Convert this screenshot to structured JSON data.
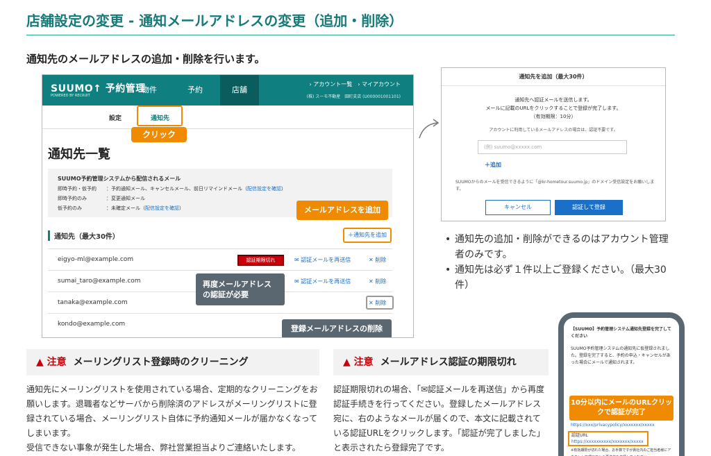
{
  "page": {
    "title": "店舗設定の変更 - 通知メールアドレスの変更（追加・削除）",
    "lead": "通知先のメールアドレスの追加・削除を行います。"
  },
  "mock": {
    "logo": "SUUMO↑ 予約管理",
    "logo_sub": "POWERED BY RECRUIT",
    "nav": [
      "物件",
      "予約",
      "店舗"
    ],
    "account_links": "› アカウント一覧　› マイアカウント",
    "account_user": "(株) スーモ不動産　田町支店 (U000001001101)",
    "subtabs": [
      "設定",
      "通知先"
    ],
    "click_label": "クリック",
    "list_title": "通知先一覧",
    "info": {
      "heading": "SUUMO予約管理システムから配信されるメール",
      "row1_label": "即時予約・仮予約",
      "row1_value": "：予約通知メール、キャンセルメール、前日リマインドメール（",
      "row1_link": "配信設定を確認",
      "row2_label": "即時予約のみ",
      "row2_value": "：変更通知メール",
      "row3_label": "仮予約のみ",
      "row3_value": "：未確定メール（",
      "row3_link": "配信設定を確認",
      "close": "）"
    },
    "add_tip": "メールアドレスを追加",
    "section_head": "通知先（最大30件）",
    "add_button": "＋通知先を追加",
    "rows": [
      {
        "email": "eigyo-ml@example.com",
        "expired": "認証期限切れ",
        "resend": "✉ 認証メールを再送信",
        "delete": "✕ 削除"
      },
      {
        "email": "sumai_taro@example.com",
        "resend": "✉ 認証メールを再送信",
        "delete": "✕ 削除"
      },
      {
        "email": "tanaka@example.com",
        "delete": "✕ 削除"
      },
      {
        "email": "kondo@example.com"
      }
    ],
    "reauth_tip": "再度メールアドレスの認証が必要",
    "delete_tip": "登録メールアドレスの削除"
  },
  "dialog": {
    "title": "通知先を追加（最大30件）",
    "msg1": "通知先へ認証メールを送信します。",
    "msg2": "メールに記載のURLをクリックすることで登録が完了します。",
    "msg3": "（有効期限：10分）",
    "note": "アカウントに利用しているメールアドレスの場合は、認証不要です。",
    "placeholder": "(例) suumo@xxxxx.com",
    "add": "＋追加",
    "domain": "SUUMOからのメールを受信できるように「@kr-hometour.suumo.jp」のドメイン受信設定をお願いします。",
    "cancel": "キャンセル",
    "ok": "認証して登録"
  },
  "bullets": [
    "通知先の追加・削除ができるのはアカウント管理者のみです。",
    "通知先は必ず１件以上ご登録ください。（最大30件）"
  ],
  "note1": {
    "warn": "▲ 注意",
    "title": "メーリングリスト登録時のクリーニング",
    "body1": "通知先にメーリングリストを使用されている場合、定期的なクリーニングをお願いします。退職者などサーバから削除済のアドレスがメーリングリストに登録されている場合、メーリングリスト自体に予約通知メールが届かなくなってしまいます。",
    "body2": "受信できない事象が発生した場合、弊社営業担当よりご連絡いたします。"
  },
  "note2": {
    "warn": "▲ 注意",
    "title": "メールアドレス認証の期限切れ",
    "body": "認証期限切れの場合、「✉認証メールを再送信」から再度認証手続きを行ってください。登録したメールアドレス宛に、右のようなメールが届くので、本文に記載されている認証URLをクリックします。「認証が完了しました」と表示されたら登録完了です。"
  },
  "phone": {
    "title": "【SUUMO】予約管理システム通知先登録を完了してください",
    "body": "SUUMO予約管理システムの通知先に仮登録されました。登録を完了すると、予約の申込・キャンセルがあった場合にメールで通知されます。",
    "tip": "10分以内にメールのURLクリックで認証が完了",
    "policy": "https://xxx/privacypolicy/xxxxxxx/xxxxx",
    "url_label": "認証URL",
    "url": "https://xxxxxxxxxx/xxxxxxx/xxxxx",
    "foot": "※有効期限が切れた場合、お手数ですが貴社内のご担当者様にアカウント管理画面から再送信を依頼してください"
  },
  "colors": {
    "teal": "#0f7f80",
    "orange": "#f08a00",
    "blue": "#1a6fc9",
    "red": "#c7000b"
  }
}
